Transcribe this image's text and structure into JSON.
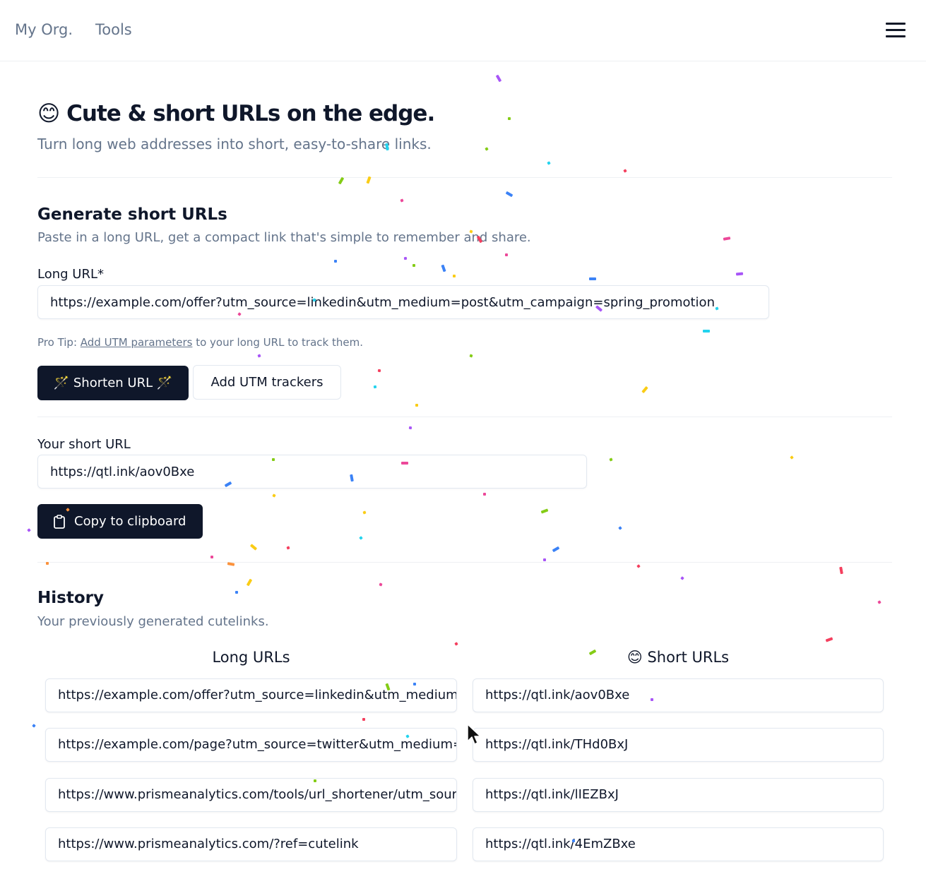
{
  "nav": {
    "brand": "My Org.",
    "tools": "Tools"
  },
  "hero": {
    "emoji": "😊",
    "title": "Cute & short URLs on the edge.",
    "subtitle": "Turn long web addresses into short, easy-to-share links."
  },
  "generate": {
    "title": "Generate short URLs",
    "subtitle": "Paste in a long URL, get a compact link that's simple to remember and share.",
    "long_url_label": "Long URL*",
    "long_url_value": "https://example.com/offer?utm_source=linkedin&utm_medium=post&utm_campaign=spring_promotion",
    "protip_prefix": "Pro Tip: ",
    "protip_link": "Add UTM parameters",
    "protip_suffix": " to your long URL to track them.",
    "shorten_label": "🪄 Shorten URL 🪄",
    "utm_label": "Add UTM trackers"
  },
  "result": {
    "label": "Your short URL",
    "value": "https://qtl.ink/aov0Bxe",
    "copy_label": "Copy to clipboard",
    "copy_icon": "clipboard-icon"
  },
  "history": {
    "title": "History",
    "subtitle": "Your previously generated cutelinks.",
    "long_header": "Long URLs",
    "short_header": "😊 Short URLs",
    "rows": [
      {
        "long": "https://example.com/offer?utm_source=linkedin&utm_medium=post&utm_campaign=spring_promotion",
        "short": "https://qtl.ink/aov0Bxe"
      },
      {
        "long": "https://example.com/page?utm_source=twitter&utm_medium=social",
        "short": "https://qtl.ink/THd0BxJ"
      },
      {
        "long": "https://www.prismeanalytics.com/tools/url_shortener/utm_source",
        "short": "https://qtl.ink/lIEZBxJ"
      },
      {
        "long": "https://www.prismeanalytics.com/?ref=cutelink",
        "short": "https://qtl.ink/4EmZBxe"
      }
    ]
  },
  "colors": {
    "primary": "#0f172a",
    "muted": "#64748b",
    "border": "#e2e8f0",
    "confetti": [
      "#f43f5e",
      "#a855f7",
      "#3b82f6",
      "#22d3ee",
      "#84cc16",
      "#facc15",
      "#ec4899",
      "#fb923c"
    ]
  }
}
